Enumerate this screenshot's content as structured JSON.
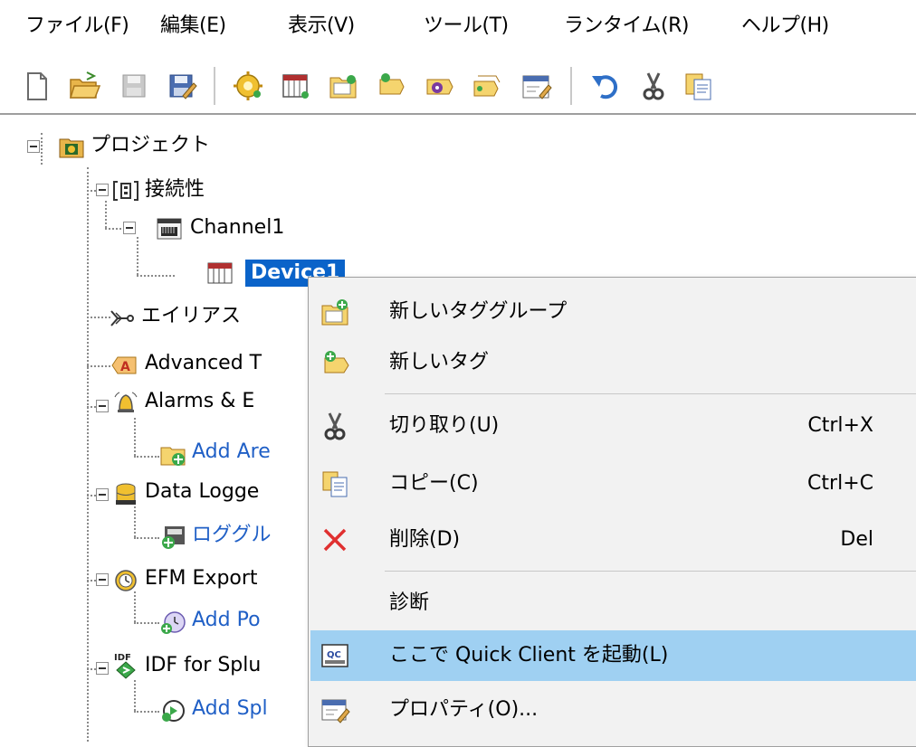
{
  "menubar": {
    "file": "ファイル(F)",
    "edit": "編集(E)",
    "view": "表示(V)",
    "tools": "ツール(T)",
    "runtime": "ランタイム(R)",
    "help": "ヘルプ(H)"
  },
  "tree": {
    "project": "プロジェクト",
    "connectivity": "接続性",
    "channel": "Channel1",
    "device": "Device1",
    "aliases": "エイリアス",
    "advanced": "Advanced T",
    "alarms": "Alarms & E",
    "add_area": "Add Are",
    "data_logger": "Data Logge",
    "log_group": "ロググル",
    "efm_export": "EFM Export",
    "add_poll": "Add Po",
    "idf_splunk": "IDF for Splu",
    "add_splunk": "Add Spl"
  },
  "context_menu": {
    "new_tag_group": "新しいタググループ",
    "new_tag": "新しいタグ",
    "cut": "切り取り(U)",
    "cut_shortcut": "Ctrl+X",
    "copy": "コピー(C)",
    "copy_shortcut": "Ctrl+C",
    "delete": "削除(D)",
    "delete_shortcut": "Del",
    "diagnostics": "診断",
    "quick_client": "ここで Quick Client を起動(L)",
    "properties": "プロパティ(O)...",
    "qc_icon_text": "QC"
  },
  "icon_text": {
    "idf": "IDF",
    "advanced": "A"
  },
  "colors": {
    "selection": "#0a63c9",
    "menu_highlight": "#9fd0f2",
    "link_text": "#1f5fc6",
    "delete_red": "#e03030"
  }
}
